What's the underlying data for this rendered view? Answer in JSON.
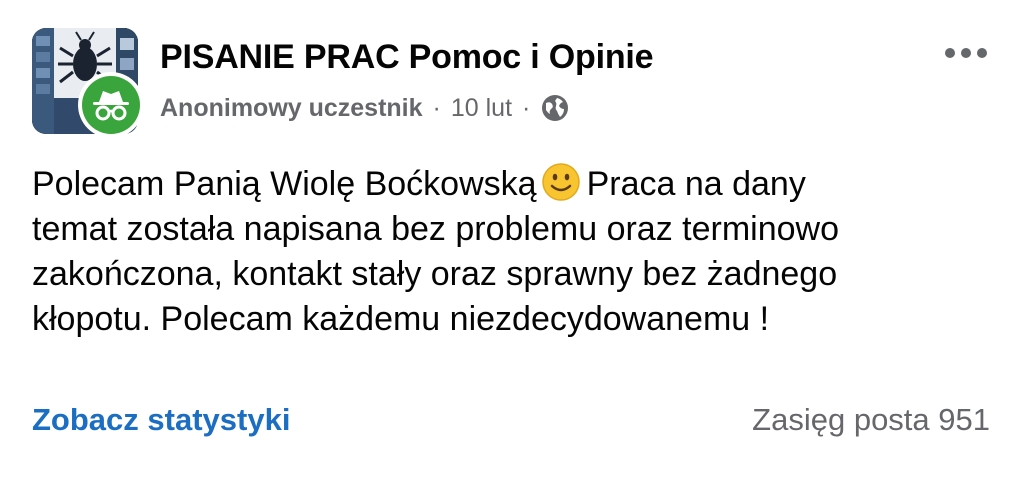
{
  "post": {
    "group_name": "PISANIE PRAC Pomoc i Opinie",
    "author": "Anonimowy uczestnik",
    "separator": "·",
    "date": "10 lut",
    "visibility_icon": "globe-icon",
    "more_icon": "more-options-icon",
    "avatar_icon": "incognito-icon",
    "text_lines": [
      "Polecam Panią Wiolę Boćkowską",
      "Praca na dany",
      "temat została napisana bez problemu oraz terminowo",
      "zakończona, kontakt stały oraz sprawny bez żadnego",
      "kłopotu. Polecam każdemu niezdecydowanemu !"
    ],
    "emoji": "slightly-smiling-face-emoji"
  },
  "footer": {
    "stats_label": "Zobacz statystyki",
    "reach_label": "Zasięg posta 951"
  },
  "colors": {
    "link": "#1b6ec2",
    "secondary_text": "#65676b",
    "badge_green": "#3aa53c"
  }
}
